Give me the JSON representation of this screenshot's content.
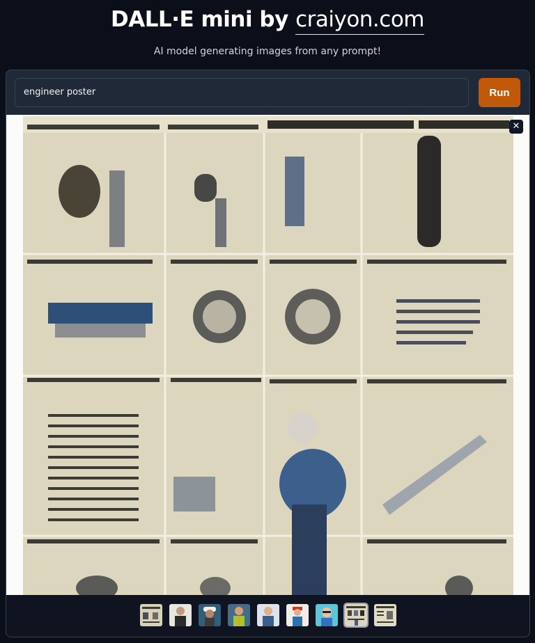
{
  "header": {
    "title_prefix": "DALL·E mini by ",
    "title_link": "craiyon.com",
    "subtitle": "AI model generating images from any prompt!"
  },
  "prompt": {
    "value": "engineer poster",
    "run_label": "Run"
  },
  "gallery": {
    "close_glyph": "✕",
    "selected_index": 7,
    "thumbnails": [
      {
        "icon": "poster-thumbnail"
      },
      {
        "icon": "engineer-portrait-thumbnail"
      },
      {
        "icon": "hardhat-engineer-thumbnail"
      },
      {
        "icon": "worker-vest-thumbnail"
      },
      {
        "icon": "engineer-portrait-thumbnail"
      },
      {
        "icon": "worker-cap-thumbnail"
      },
      {
        "icon": "engineer-cartoon-thumbnail"
      },
      {
        "icon": "poster-thumbnail"
      },
      {
        "icon": "poster-thumbnail"
      }
    ]
  },
  "colors": {
    "background": "#0b0f19",
    "panel": "#1f2937",
    "run_button": "#c2590a",
    "poster_paper": "#ddd6bf"
  }
}
